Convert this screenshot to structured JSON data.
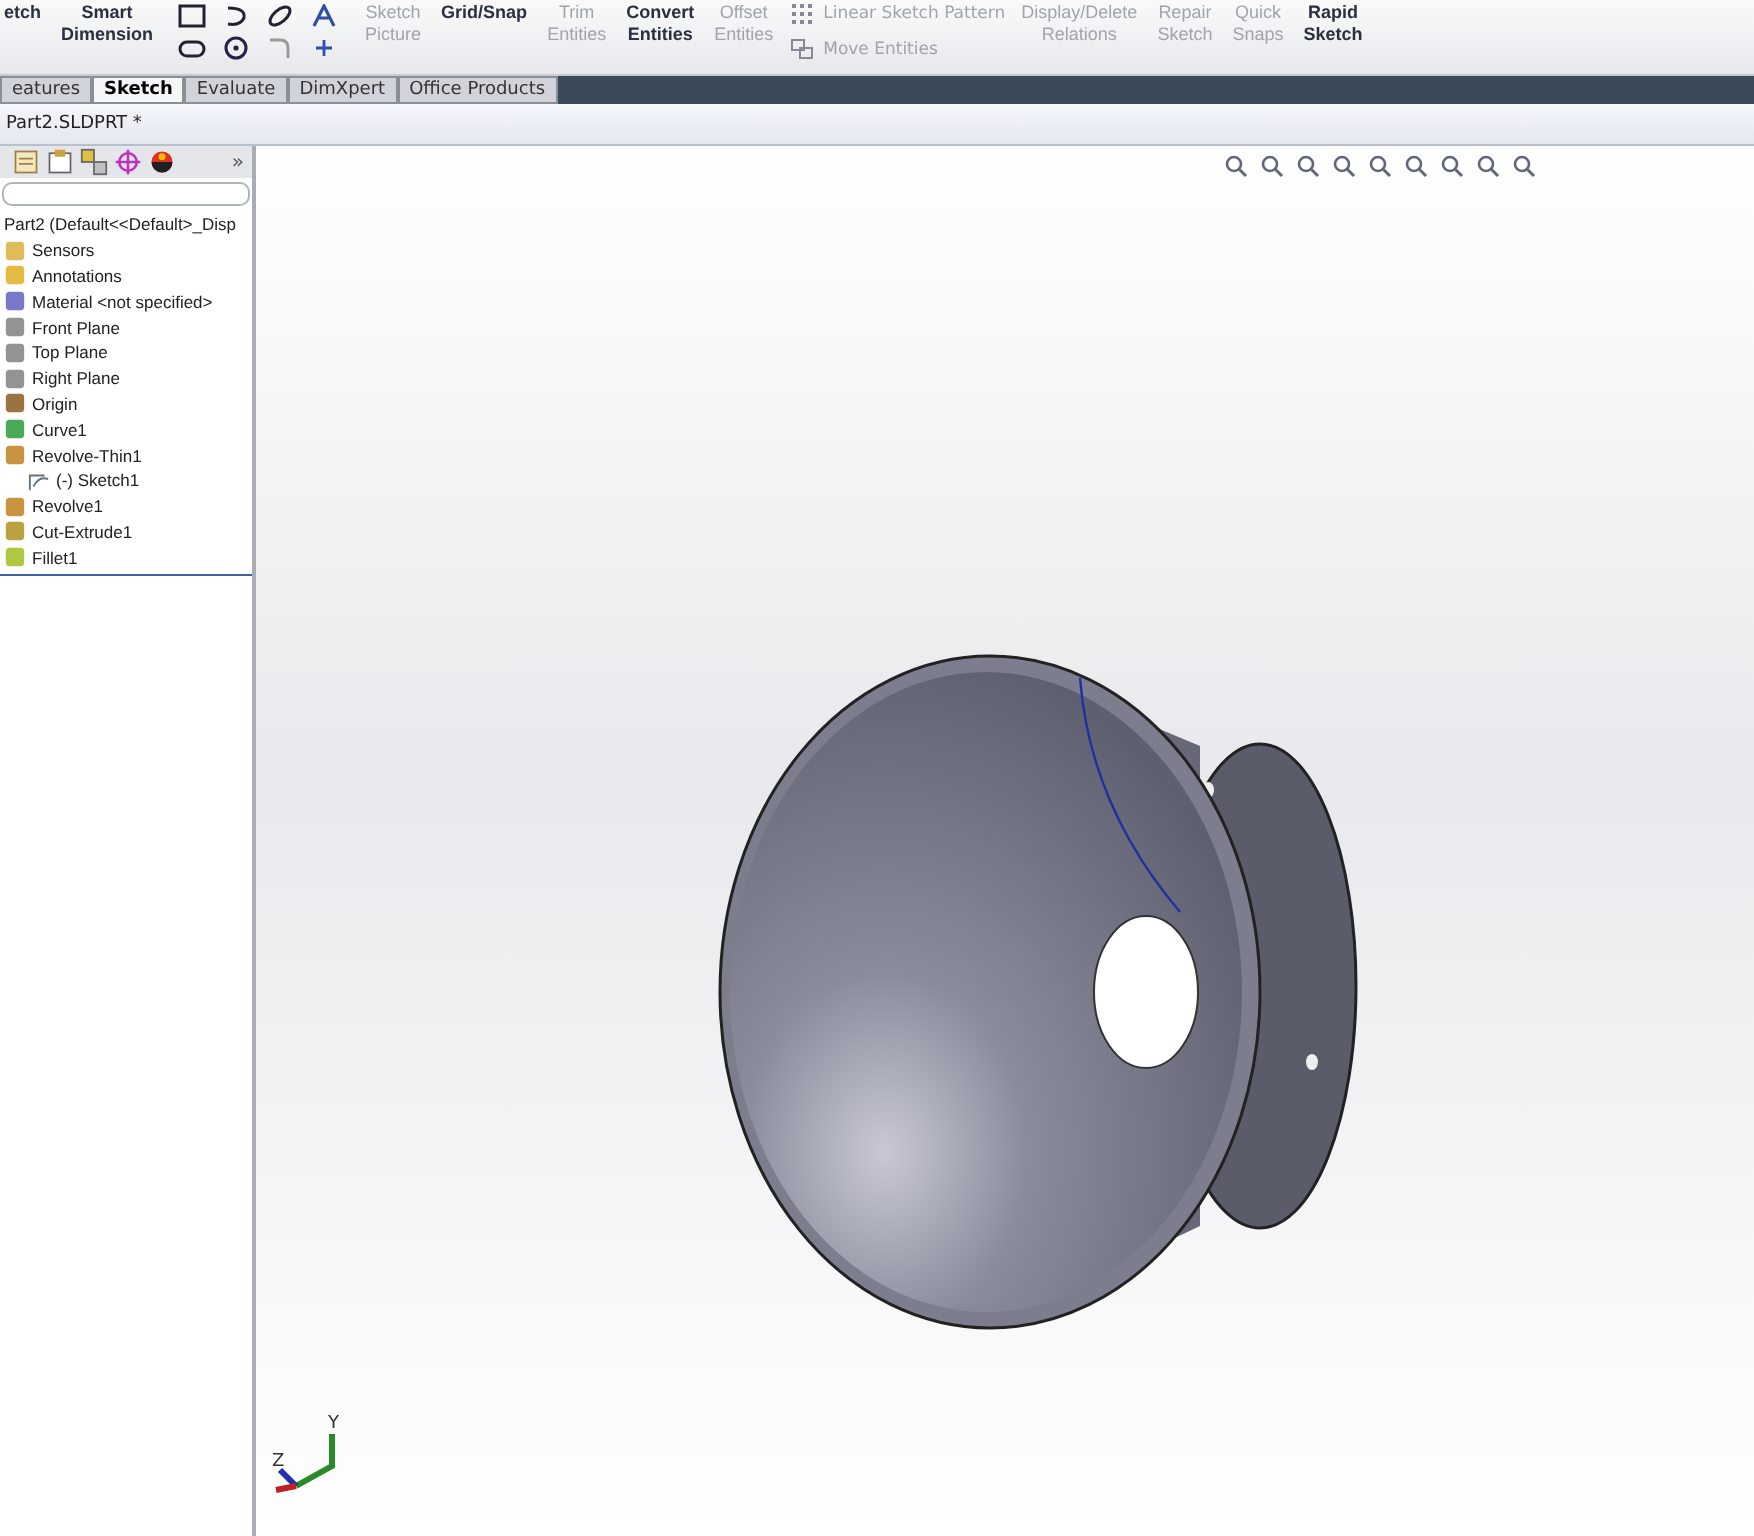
{
  "toolbar": {
    "groups": [
      {
        "kind": "tool",
        "lines": [
          "etch"
        ],
        "enabled": true
      },
      {
        "kind": "tool",
        "lines": [
          "Smart",
          "Dimension"
        ],
        "enabled": true
      },
      {
        "kind": "shapes"
      },
      {
        "kind": "tool",
        "lines": [
          "Sketch",
          "Picture"
        ],
        "enabled": false
      },
      {
        "kind": "tool",
        "lines": [
          "Grid/Snap"
        ],
        "enabled": true
      },
      {
        "kind": "tool",
        "lines": [
          "Trim",
          "Entities"
        ],
        "enabled": false
      },
      {
        "kind": "tool",
        "lines": [
          "Convert",
          "Entities"
        ],
        "enabled": true
      },
      {
        "kind": "tool",
        "lines": [
          "Offset",
          "Entities"
        ],
        "enabled": false
      },
      {
        "kind": "pair",
        "lines": [
          "Linear Sketch Pattern",
          "Move Entities"
        ],
        "enabled": false
      },
      {
        "kind": "tool",
        "lines": [
          "Display/Delete",
          "Relations"
        ],
        "enabled": false
      },
      {
        "kind": "tool",
        "lines": [
          "Repair",
          "Sketch"
        ],
        "enabled": false
      },
      {
        "kind": "tool",
        "lines": [
          "Quick",
          "Snaps"
        ],
        "enabled": false
      },
      {
        "kind": "tool",
        "lines": [
          "Rapid",
          "Sketch"
        ],
        "enabled": true
      }
    ]
  },
  "tabs": [
    {
      "label": "eatures",
      "selected": false
    },
    {
      "label": "Sketch",
      "selected": true
    },
    {
      "label": "Evaluate",
      "selected": false
    },
    {
      "label": "DimXpert",
      "selected": false
    },
    {
      "label": "Office Products",
      "selected": false
    }
  ],
  "document": {
    "title": "Part2.SLDPRT *"
  },
  "panel": {
    "more": "»",
    "tree": {
      "label": "Part2  (Default<<Default>_Disp",
      "children": [
        {
          "label": "Sensors",
          "kind": "sensors"
        },
        {
          "label": "Annotations",
          "kind": "annotations"
        },
        {
          "label": "Material <not specified>",
          "kind": "material"
        },
        {
          "label": "Front Plane",
          "kind": "plane"
        },
        {
          "label": "Top Plane",
          "kind": "plane"
        },
        {
          "label": "Right Plane",
          "kind": "plane"
        },
        {
          "label": "Origin",
          "kind": "origin"
        },
        {
          "label": "Curve1",
          "kind": "curve"
        },
        {
          "label": "Revolve-Thin1",
          "kind": "revolve",
          "children": [
            {
              "label": "(-) Sketch1",
              "kind": "sketch"
            }
          ]
        },
        {
          "label": "Revolve1",
          "kind": "revolve"
        },
        {
          "label": "Cut-Extrude1",
          "kind": "cut"
        },
        {
          "label": "Fillet1",
          "kind": "fillet"
        }
      ]
    }
  },
  "viewport": {
    "triad": {
      "x_label": "Z",
      "y_label": "Y"
    }
  }
}
